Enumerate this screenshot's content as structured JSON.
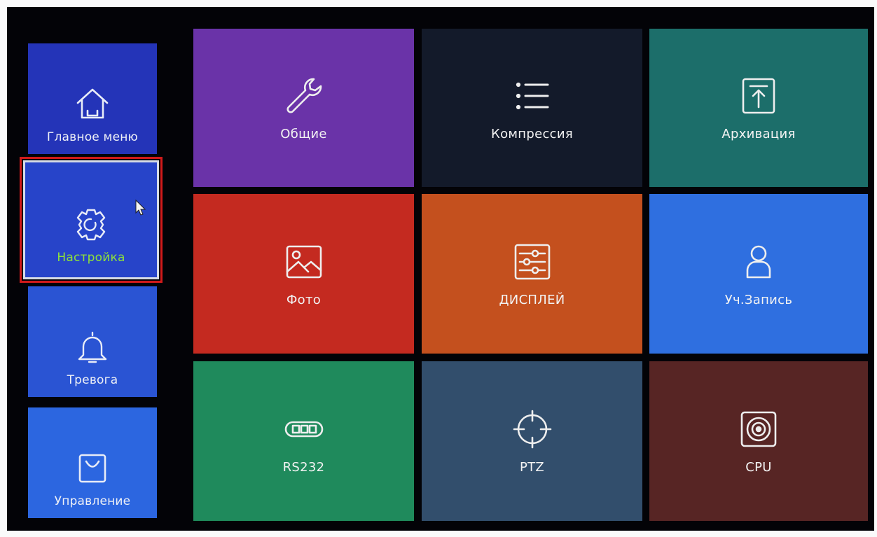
{
  "sidebar": {
    "items": [
      {
        "label": "Главное меню",
        "icon": "home-icon",
        "color": "#2434b8",
        "selected": false
      },
      {
        "label": "Настройка",
        "icon": "gear-icon",
        "color": "#2744c9",
        "selected": true
      },
      {
        "label": "Тревога",
        "icon": "bell-icon",
        "color": "#2a54d3",
        "selected": false
      },
      {
        "label": "Управление",
        "icon": "bag-icon",
        "color": "#2c66e0",
        "selected": false
      }
    ]
  },
  "grid": {
    "tiles": [
      {
        "label": "Общие",
        "icon": "wrench-icon",
        "color": "#6a33a8"
      },
      {
        "label": "Компрессия",
        "icon": "list-icon",
        "color": "#131a2a"
      },
      {
        "label": "Архивация",
        "icon": "upload-icon",
        "color": "#1c6e6a"
      },
      {
        "label": "Фото",
        "icon": "image-icon",
        "color": "#c42a20"
      },
      {
        "label": "ДИСПЛЕЙ",
        "icon": "sliders-icon",
        "color": "#c4501e"
      },
      {
        "label": "Уч.Запись",
        "icon": "user-icon",
        "color": "#2f6fe0"
      },
      {
        "label": "RS232",
        "icon": "port-icon",
        "color": "#1f8a5c"
      },
      {
        "label": "PTZ",
        "icon": "crosshair-icon",
        "color": "#324e6c"
      },
      {
        "label": "CPU",
        "icon": "speaker-icon",
        "color": "#572524"
      }
    ]
  },
  "selection_color": "#d11a1a",
  "selected_label_color": "#8ee238"
}
